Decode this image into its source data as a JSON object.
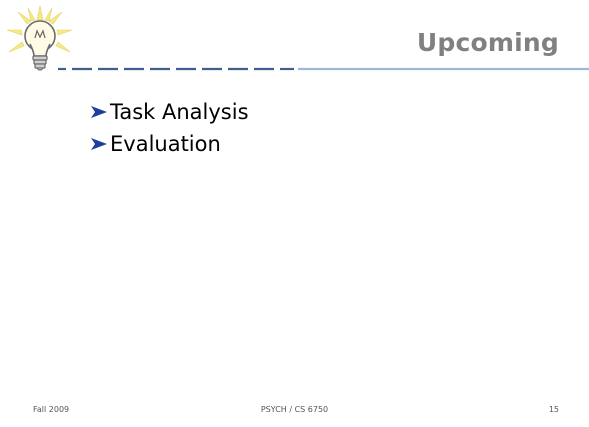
{
  "slide": {
    "title": "Upcoming",
    "bullets": [
      {
        "label": "Task Analysis"
      },
      {
        "label": "Evaluation"
      }
    ],
    "footer": {
      "left": "Fall 2009",
      "center": "PSYCH / CS 6750",
      "right": "15"
    }
  },
  "colors": {
    "title": "#808080",
    "rule_dark": "#3f5f8f",
    "rule_light": "#9fb7d8",
    "bullet_arrow": "#1f3f9f",
    "bulb_glow": "#f5e98a"
  },
  "icons": {
    "logo": "light-bulb-icon",
    "bullet": "arrow-bullet-icon"
  }
}
